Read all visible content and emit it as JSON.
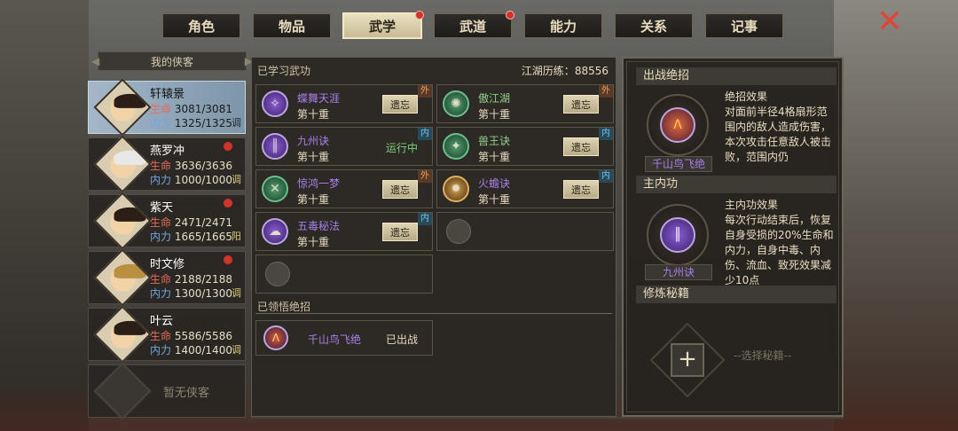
{
  "tabs": [
    {
      "label": "角色",
      "active": false,
      "alert": false
    },
    {
      "label": "物品",
      "active": false,
      "alert": false
    },
    {
      "label": "武学",
      "active": true,
      "alert": true
    },
    {
      "label": "武道",
      "active": false,
      "alert": true
    },
    {
      "label": "能力",
      "active": false,
      "alert": false
    },
    {
      "label": "关系",
      "active": false,
      "alert": false
    },
    {
      "label": "记事",
      "active": false,
      "alert": false
    }
  ],
  "close_icon": "✕",
  "my_header": "我的侠客",
  "characters": [
    {
      "name": "轩辕景",
      "hp_label": "生命",
      "hp": "3081/3081",
      "mp_label": "内力",
      "mp": "1325/1325",
      "tag": "调",
      "alert": false,
      "selected": true
    },
    {
      "name": "燕罗冲",
      "hp_label": "生命",
      "hp": "3636/3636",
      "mp_label": "内力",
      "mp": "1000/1000",
      "tag": "调",
      "alert": true,
      "selected": false
    },
    {
      "name": "紫天",
      "hp_label": "生命",
      "hp": "2471/2471",
      "mp_label": "内力",
      "mp": "1665/1665",
      "tag": "阳",
      "alert": true,
      "selected": false
    },
    {
      "name": "时文修",
      "hp_label": "生命",
      "hp": "2188/2188",
      "mp_label": "内力",
      "mp": "1300/1300",
      "tag": "调",
      "alert": true,
      "selected": false
    },
    {
      "name": "叶云",
      "hp_label": "生命",
      "hp": "5586/5586",
      "mp_label": "内力",
      "mp": "1400/1400",
      "tag": "调",
      "alert": false,
      "selected": false
    }
  ],
  "empty_slot": "暂无侠客",
  "learned": {
    "title": "已学习武功",
    "exp_label": "江湖历练：",
    "exp_value": "88556",
    "skills": [
      {
        "name": "蝶舞天涯",
        "level": "第十重",
        "action": "遗忘",
        "badge": "外",
        "style": "purple",
        "glyph": "✧"
      },
      {
        "name": "傲江湖",
        "level": "第十重",
        "action": "遗忘",
        "badge": "外",
        "style": "green",
        "glyph": "✺"
      },
      {
        "name": "九州诀",
        "level": "第十重",
        "action": "运行中",
        "badge": "内",
        "style": "purple",
        "glyph": "║"
      },
      {
        "name": "兽王诀",
        "level": "第十重",
        "action": "遗忘",
        "badge": "内",
        "style": "green",
        "glyph": "✦"
      },
      {
        "name": "惊鸿一梦",
        "level": "第十重",
        "action": "遗忘",
        "badge": "外",
        "style": "green",
        "glyph": "✕"
      },
      {
        "name": "火蟾诀",
        "level": "第十重",
        "action": "遗忘",
        "badge": "内",
        "style": "gold",
        "glyph": "✹"
      },
      {
        "name": "五毒秘法",
        "level": "第十重",
        "action": "遗忘",
        "badge": "内",
        "style": "purple",
        "glyph": "☁"
      }
    ]
  },
  "ultimates": {
    "title": "已领悟绝招",
    "items": [
      {
        "name": "千山鸟飞绝",
        "status": "已出战",
        "glyph": "ᐱ"
      }
    ]
  },
  "right": {
    "battle_title": "出战绝招",
    "battle_effect_title": "绝招效果",
    "battle_effect_text": "对面前半径4格扇形范围内的敌人造成伤害，本次攻击任意敌人被击败，范围内仍",
    "battle_name": "千山鸟飞绝",
    "inner_title": "主内功",
    "inner_effect_title": "主内功效果",
    "inner_effect_text": "每次行动结束后，恢复自身受损的20%生命和内力，自身中毒、内伤、流血、致死效果减少10点",
    "inner_name": "九州诀",
    "secret_title": "修炼秘籍",
    "plus": "+",
    "choose_placeholder": "--选择秘籍--"
  }
}
